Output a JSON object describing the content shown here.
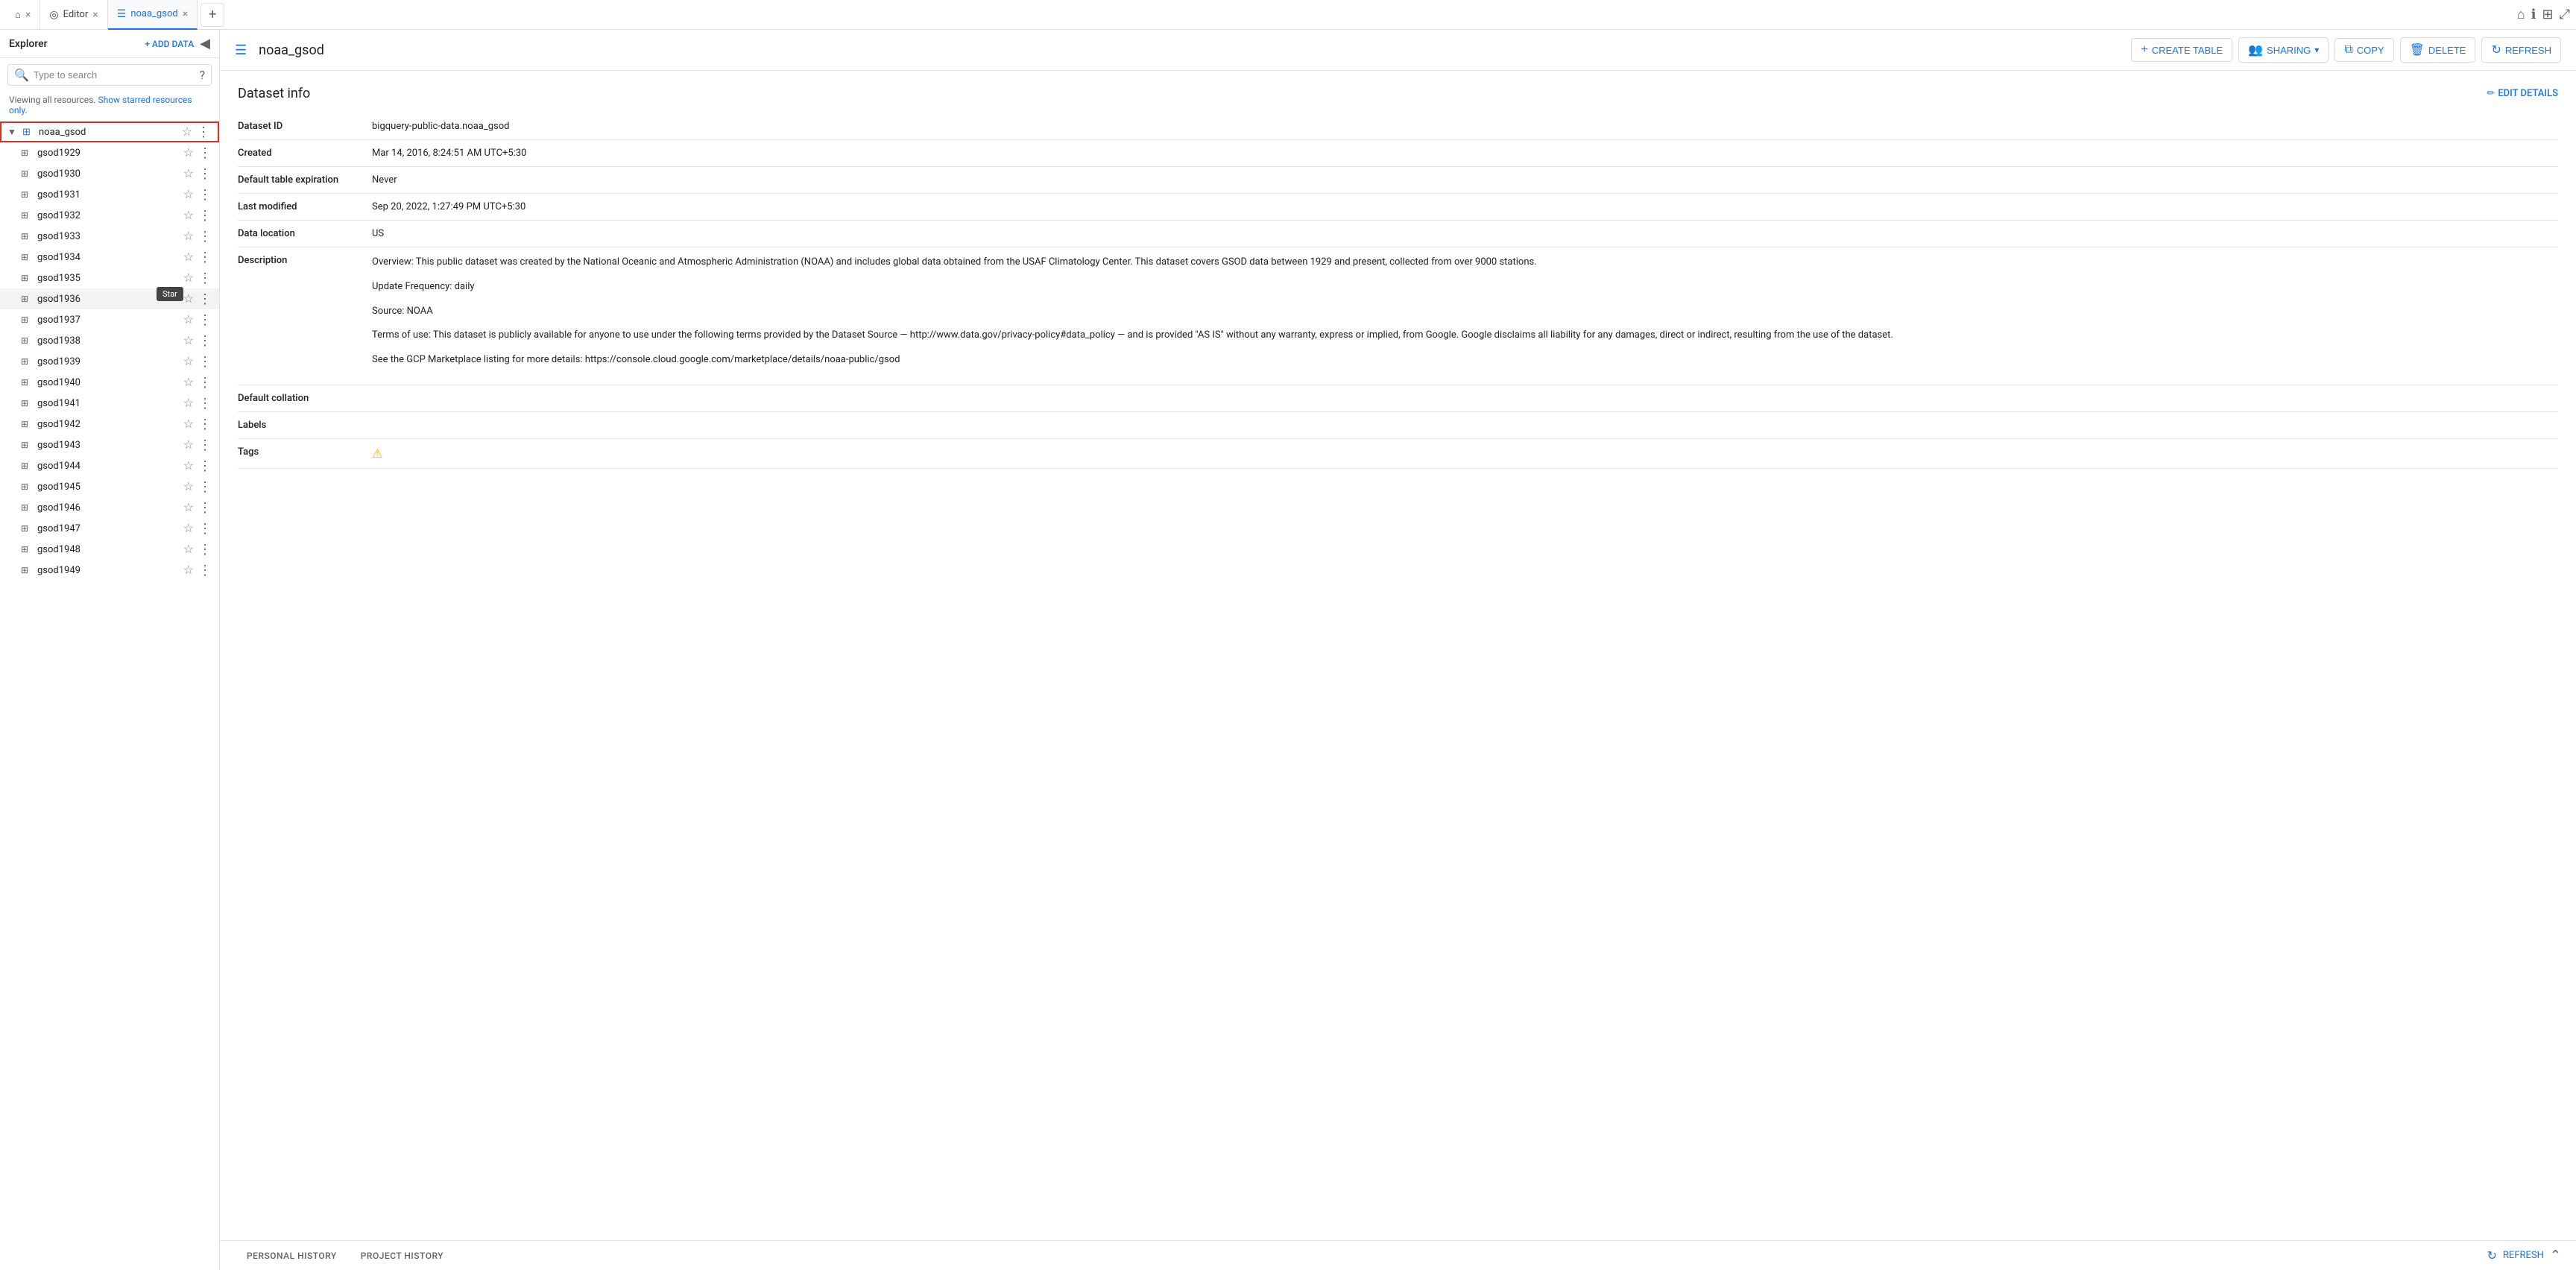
{
  "app": {
    "title": "Explorer"
  },
  "topbar": {
    "home_icon": "⌂",
    "close_icon": "×",
    "add_tab_icon": "+",
    "tabs": [
      {
        "id": "home",
        "label": "",
        "icon": "⌂",
        "closable": false
      },
      {
        "id": "editor",
        "label": "Editor",
        "icon": "◎",
        "closable": true
      },
      {
        "id": "noaa_gsod",
        "label": "noaa_gsod",
        "icon": "☰",
        "closable": true,
        "active": true
      }
    ],
    "icons_right": [
      "⌂",
      "ℹ",
      "⊞",
      "⤢"
    ]
  },
  "sidebar": {
    "title": "Explorer",
    "add_data_label": "+ ADD DATA",
    "collapse_icon": "◀",
    "search_placeholder": "Type to search",
    "help_icon": "?",
    "viewing_text": "Viewing all resources.",
    "show_starred_link": "Show starred resources only.",
    "dataset": {
      "name": "noaa_gsod",
      "expanded": true
    },
    "tables": [
      "gsod1929",
      "gsod1930",
      "gsod1931",
      "gsod1932",
      "gsod1933",
      "gsod1934",
      "gsod1935",
      "gsod1936",
      "gsod1937",
      "gsod1938",
      "gsod1939",
      "gsod1940",
      "gsod1941",
      "gsod1942",
      "gsod1943",
      "gsod1944",
      "gsod1945",
      "gsod1946",
      "gsod1947",
      "gsod1948",
      "gsod1949"
    ],
    "highlighted_table": "gsod1936",
    "tooltip_text": "Star"
  },
  "content": {
    "page_icon": "☰",
    "page_title": "noaa_gsod",
    "actions": {
      "create_table": "CREATE TABLE",
      "sharing": "SHARING",
      "copy": "COPY",
      "delete": "DELETE",
      "refresh": "REFRESH"
    },
    "section_title": "Dataset info",
    "edit_details": "EDIT DETAILS",
    "fields": {
      "dataset_id_label": "Dataset ID",
      "dataset_id_value": "bigquery-public-data.noaa_gsod",
      "created_label": "Created",
      "created_value": "Mar 14, 2016, 8:24:51 AM UTC+5:30",
      "default_expiry_label": "Default table expiration",
      "default_expiry_value": "Never",
      "last_modified_label": "Last modified",
      "last_modified_value": "Sep 20, 2022, 1:27:49 PM UTC+5:30",
      "data_location_label": "Data location",
      "data_location_value": "US",
      "description_label": "Description",
      "description_p1": "Overview: This public dataset was created by the National Oceanic and Atmospheric Administration (NOAA) and includes global data obtained from the USAF Climatology Center.  This dataset covers GSOD data between 1929 and present, collected from over 9000 stations.",
      "description_p2": "Update Frequency: daily",
      "description_p3": "Source: NOAA",
      "description_p4": "Terms of use: This dataset is publicly available for anyone to use under the following terms provided by the Dataset Source — http://www.data.gov/privacy-policy#data_policy — and is provided \"AS IS\" without any warranty, express or implied, from Google. Google disclaims all liability for any damages, direct or indirect, resulting from the use of the dataset.",
      "description_p5": "See the GCP Marketplace listing for more details: https://console.cloud.google.com/marketplace/details/noaa-public/gsod",
      "default_collation_label": "Default collation",
      "default_collation_value": "",
      "labels_label": "Labels",
      "labels_value": "",
      "tags_label": "Tags",
      "tags_warning_icon": "⚠"
    }
  },
  "bottom_bar": {
    "tabs": [
      {
        "id": "personal",
        "label": "PERSONAL HISTORY",
        "active": false
      },
      {
        "id": "project",
        "label": "PROJECT HISTORY",
        "active": false
      }
    ],
    "refresh_label": "REFRESH",
    "collapse_icon": "⌃"
  }
}
